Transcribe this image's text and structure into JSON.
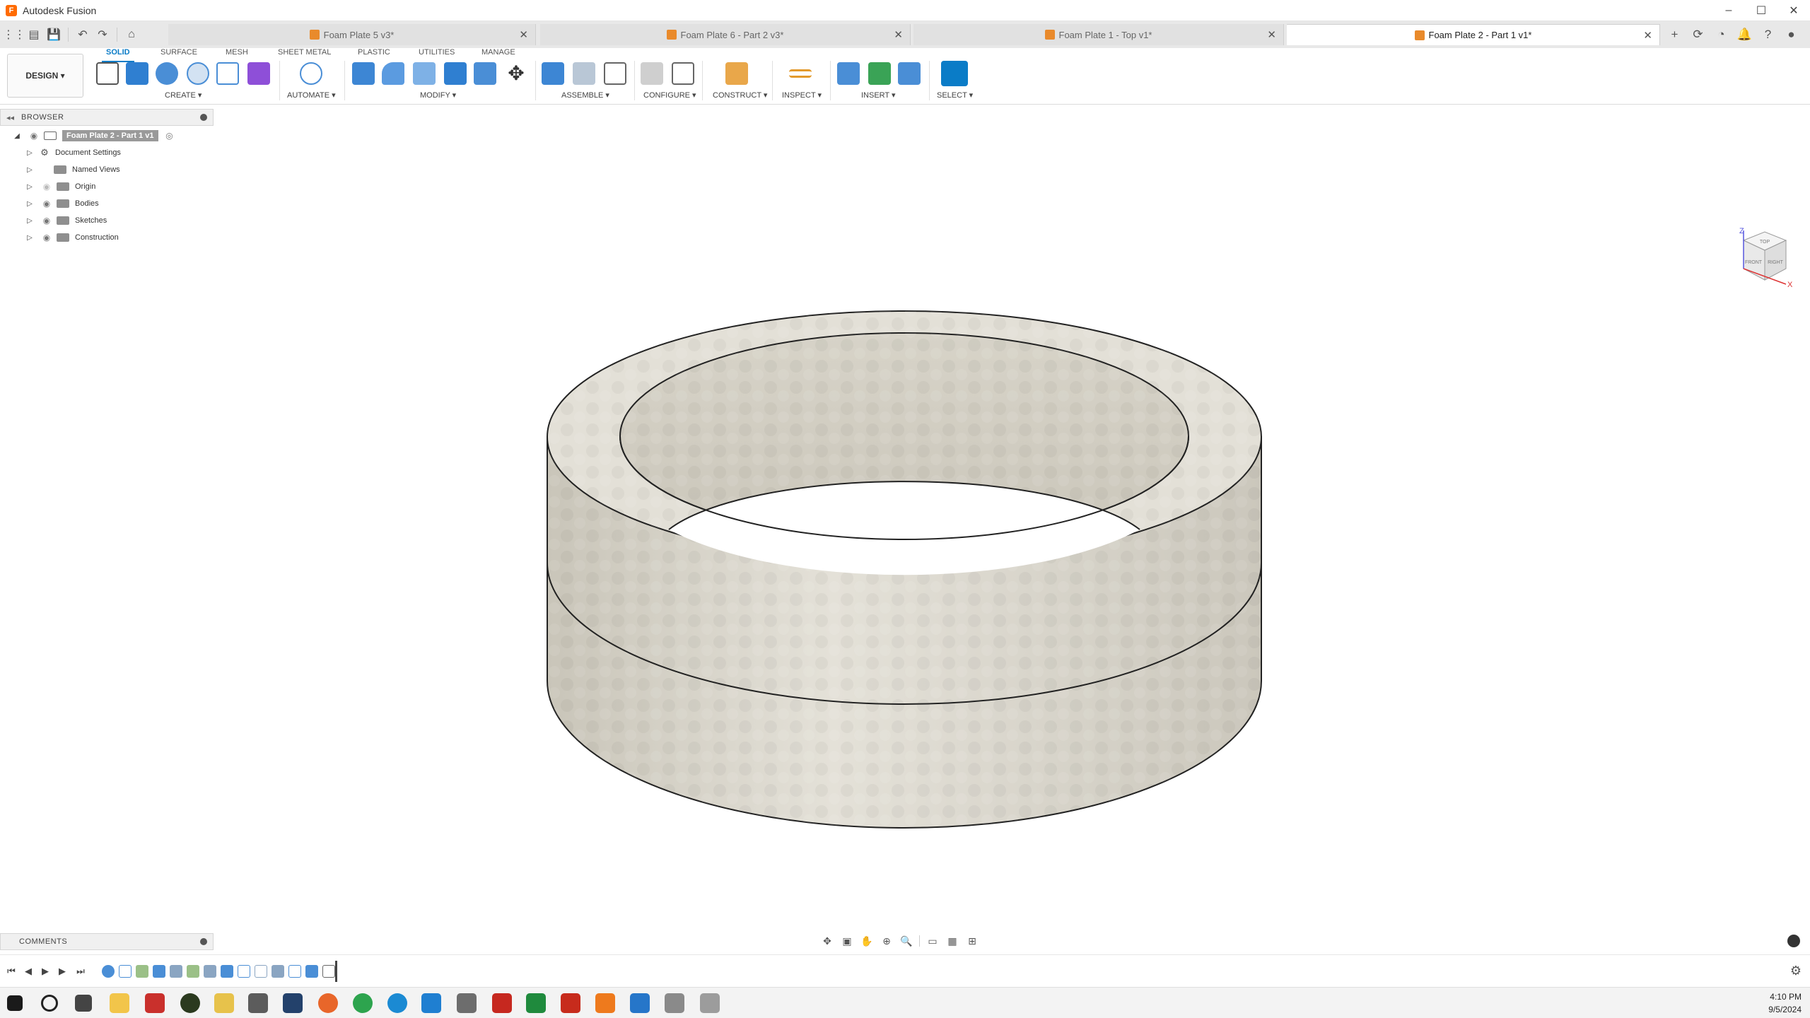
{
  "app": {
    "title": "Autodesk Fusion"
  },
  "tabs": [
    {
      "label": "Foam Plate 5 v3*",
      "active": false
    },
    {
      "label": "Foam Plate 6 - Part 2 v3*",
      "active": false
    },
    {
      "label": "Foam Plate 1 - Top v1*",
      "active": false
    },
    {
      "label": "Foam Plate 2 - Part 1 v1*",
      "active": true
    }
  ],
  "toolbar": {
    "workspace": "DESIGN ▾",
    "tabs": [
      "SOLID",
      "SURFACE",
      "MESH",
      "SHEET METAL",
      "PLASTIC",
      "UTILITIES",
      "MANAGE"
    ],
    "groups": [
      "CREATE ▾",
      "AUTOMATE ▾",
      "MODIFY ▾",
      "ASSEMBLE ▾",
      "CONFIGURE ▾",
      "CONSTRUCT ▾",
      "INSPECT ▾",
      "INSERT ▾",
      "SELECT ▾"
    ]
  },
  "browser": {
    "title": "BROWSER",
    "root": "Foam Plate 2 - Part 1 v1",
    "items": [
      "Document Settings",
      "Named Views",
      "Origin",
      "Bodies",
      "Sketches",
      "Construction"
    ]
  },
  "comments": {
    "title": "COMMENTS"
  },
  "viewcube": {
    "faces": [
      "TOP",
      "FRONT",
      "RIGHT"
    ],
    "axes": [
      "Z",
      "X"
    ]
  },
  "clock": {
    "time": "4:10 PM",
    "date": "9/5/2024"
  },
  "colors": {
    "accent": "#0a7cc7",
    "brand": "#ff6b00",
    "model": "#dcd9d0"
  }
}
